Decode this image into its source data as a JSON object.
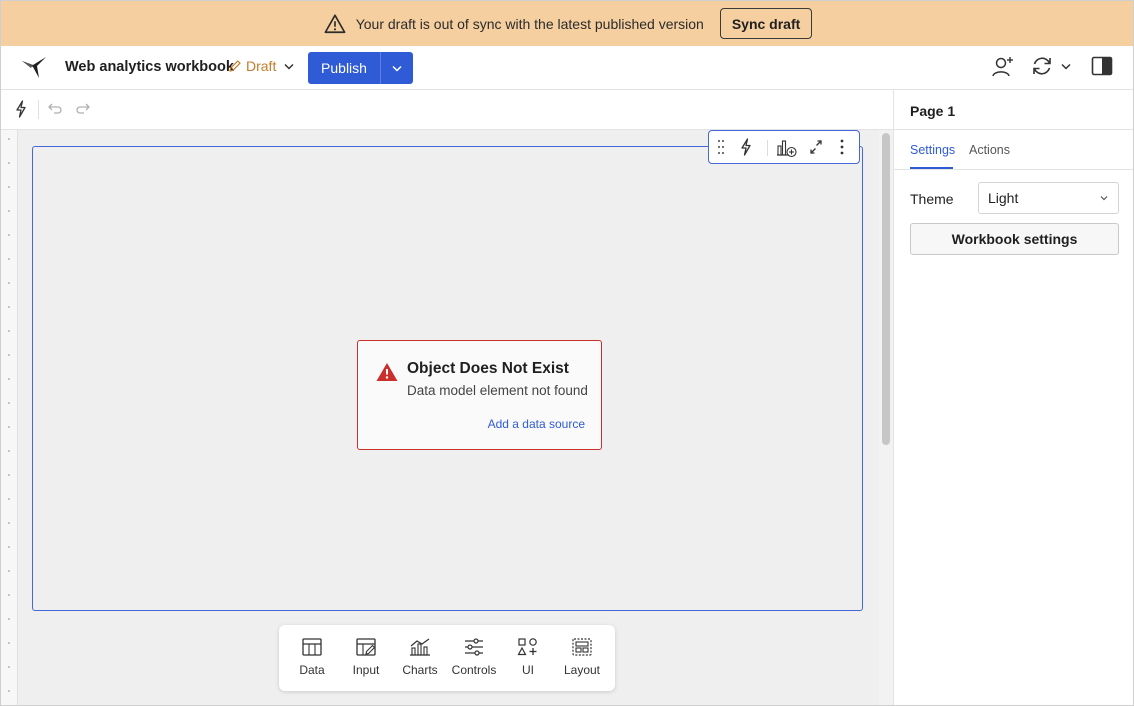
{
  "banner": {
    "message": "Your draft is out of sync with the latest published version",
    "sync_button": "Sync draft",
    "icon": "warning-triangle-icon",
    "background": "#f5cfa0"
  },
  "header": {
    "workbook_title": "Web analytics workbook",
    "draft_label": "Draft",
    "publish_label": "Publish",
    "accent": "#2f5bd6",
    "draft_color": "#c47c2a"
  },
  "element": {
    "error_title": "Object Does Not Exist",
    "error_message": "Data model element not found",
    "error_link": "Add a data source",
    "error_color": "#c9302c"
  },
  "insert_bar": {
    "items": [
      {
        "label": "Data",
        "icon": "table-icon"
      },
      {
        "label": "Input",
        "icon": "input-table-icon"
      },
      {
        "label": "Charts",
        "icon": "chart-icon"
      },
      {
        "label": "Controls",
        "icon": "sliders-icon"
      },
      {
        "label": "UI",
        "icon": "shapes-icon"
      },
      {
        "label": "Layout",
        "icon": "layout-icon"
      }
    ]
  },
  "panel": {
    "page_title": "Page 1",
    "tabs": [
      {
        "label": "Settings",
        "active": true
      },
      {
        "label": "Actions",
        "active": false
      }
    ],
    "theme_label": "Theme",
    "theme_value": "Light",
    "workbook_settings_label": "Workbook settings"
  }
}
